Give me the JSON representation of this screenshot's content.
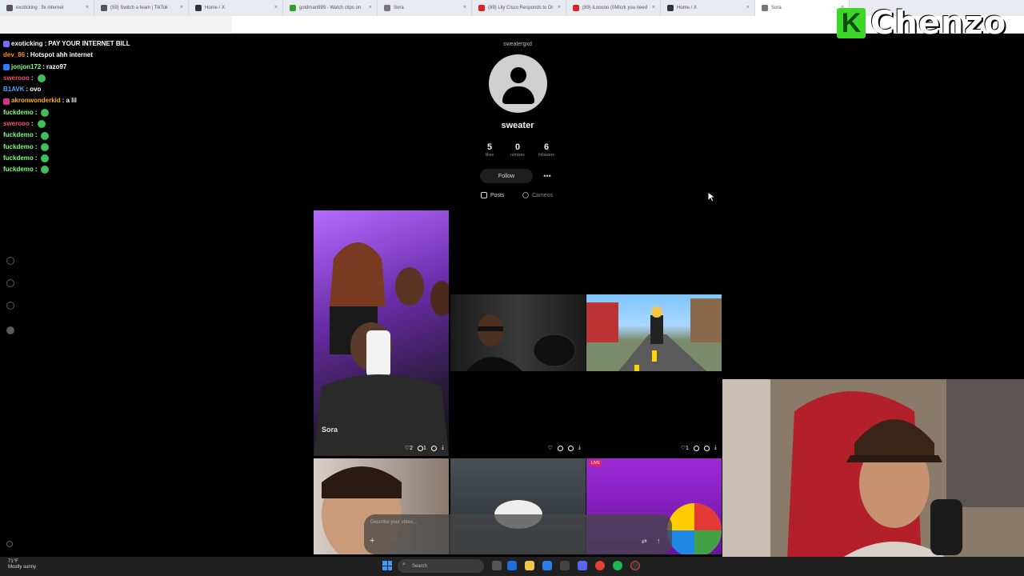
{
  "browser": {
    "tabs": [
      {
        "label": "exoticking : fix internet",
        "color": "#555"
      },
      {
        "label": "(59) Switch a team | TikTok",
        "color": "#555"
      },
      {
        "label": "Home / X",
        "color": "#333"
      },
      {
        "label": "goldman999 - Watch clips on",
        "color": "#2ca02c"
      },
      {
        "label": "Sora",
        "color": "#777"
      },
      {
        "label": "(89) Lily Cisco Responds to Dr",
        "color": "#d62728"
      },
      {
        "label": "(89) iLoosoo (0Mlcrk you need",
        "color": "#d62728"
      },
      {
        "label": "Home / X",
        "color": "#333"
      },
      {
        "label": "Sora",
        "color": "#777"
      }
    ],
    "active_tab": 8
  },
  "watermark": {
    "letter": "K",
    "name": "Chenzo"
  },
  "chat": [
    {
      "user": "exoticking",
      "msg": "PAY YOUR INTERNET BILL",
      "color": "#ffffff",
      "badge": "#7a6cff"
    },
    {
      "user": "dev_86",
      "msg": "Hotspot ahh internet",
      "color": "#ff8a00",
      "badge": ""
    },
    {
      "user": "jonjon172",
      "msg": "razo97",
      "color": "#7cff7c",
      "badge": "#2d7bff"
    },
    {
      "user": "swerooo",
      "msg": "",
      "color": "#ff4d6d",
      "badge": "",
      "emote": true
    },
    {
      "user": "B1AVK",
      "msg": "ovo",
      "color": "#4da3ff",
      "badge": ""
    },
    {
      "user": "akronwonderkid",
      "msg": "a lil",
      "color": "#ffb000",
      "badge": "#d63384"
    },
    {
      "user": "fuckdemo",
      "msg": "",
      "color": "#7cff7c",
      "badge": "",
      "emote": true
    },
    {
      "user": "swerooo",
      "msg": "",
      "color": "#ff4d6d",
      "badge": "",
      "emote": true
    },
    {
      "user": "fuckdemo",
      "msg": "",
      "color": "#7cff7c",
      "badge": "",
      "emote": true
    },
    {
      "user": "fuckdemo",
      "msg": "",
      "color": "#7cff7c",
      "badge": "",
      "emote": true
    },
    {
      "user": "fuckdemo",
      "msg": "",
      "color": "#7cff7c",
      "badge": "",
      "emote": true
    },
    {
      "user": "fuckdemo",
      "msg": "",
      "color": "#7cff7c",
      "badge": "",
      "emote": true
    }
  ],
  "profile": {
    "handle": "sweatergxd",
    "name": "sweater",
    "stats": [
      {
        "value": "5",
        "label": "likes"
      },
      {
        "value": "0",
        "label": "remixes"
      },
      {
        "value": "6",
        "label": "followers"
      }
    ],
    "follow_label": "Follow",
    "more_label": "•••",
    "tabs": [
      {
        "label": "Posts",
        "active": true
      },
      {
        "label": "Cameos",
        "active": false
      }
    ]
  },
  "posts": [
    {
      "likes": "2",
      "comments": "1",
      "sora_label": "Sora"
    },
    {
      "likes": "",
      "comments": ""
    },
    {
      "likes": "1",
      "comments": ""
    }
  ],
  "live_badge": "LIVE",
  "prompt": {
    "placeholder": "Describe your video...",
    "plus": "+",
    "settings": "⇄",
    "send": "↑"
  },
  "taskbar": {
    "temp": "71°F",
    "weather": "Mostly sunny",
    "search": "Search"
  },
  "icons": [
    "search-icon",
    "heart-icon",
    "comment-icon",
    "remix-icon",
    "download-icon",
    "user-icon",
    "mouse-cursor-icon"
  ]
}
